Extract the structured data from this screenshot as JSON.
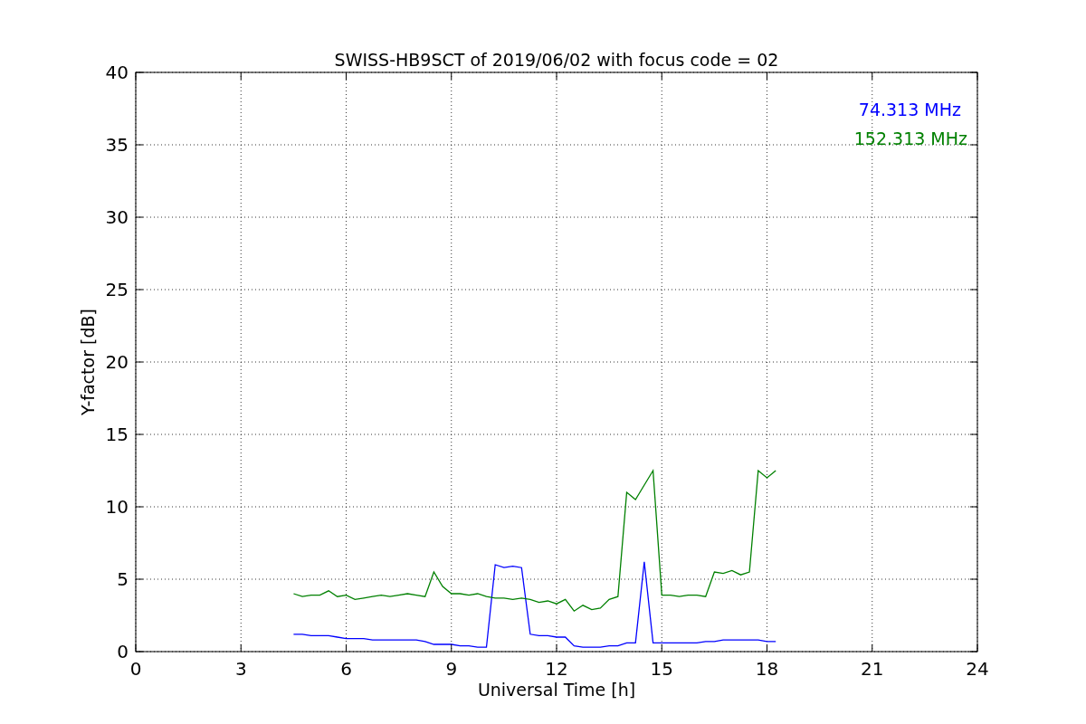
{
  "chart_data": {
    "type": "line",
    "title": "SWISS-HB9SCT of 2019/06/02 with focus code = 02",
    "xlabel": "Universal Time [h]",
    "ylabel": "Y-factor [dB]",
    "x": [
      4.5,
      4.75,
      5,
      5.25,
      5.5,
      5.75,
      6,
      6.25,
      6.5,
      6.75,
      7,
      7.25,
      7.5,
      7.75,
      8,
      8.25,
      8.5,
      8.75,
      9,
      9.25,
      9.5,
      9.75,
      10,
      10.25,
      10.5,
      10.75,
      11,
      11.25,
      11.5,
      11.75,
      12,
      12.25,
      12.5,
      12.75,
      13,
      13.25,
      13.5,
      13.75,
      14,
      14.25,
      14.5,
      14.75,
      15,
      15.25,
      15.5,
      15.75,
      16,
      16.25,
      16.5,
      16.75,
      17,
      17.25,
      17.5,
      17.75,
      18,
      18.25
    ],
    "series": [
      {
        "name": "74.313 MHz",
        "color": "#0000ff",
        "values": [
          1.2,
          1.2,
          1.1,
          1.1,
          1.1,
          1.0,
          0.9,
          0.9,
          0.9,
          0.8,
          0.8,
          0.8,
          0.8,
          0.8,
          0.8,
          0.7,
          0.5,
          0.5,
          0.5,
          0.4,
          0.4,
          0.3,
          0.3,
          6.0,
          5.8,
          5.9,
          5.8,
          1.2,
          1.1,
          1.1,
          1.0,
          1.0,
          0.4,
          0.3,
          0.3,
          0.3,
          0.4,
          0.4,
          0.6,
          0.6,
          6.2,
          0.6,
          0.6,
          0.6,
          0.6,
          0.6,
          0.6,
          0.7,
          0.7,
          0.8,
          0.8,
          0.8,
          0.8,
          0.8,
          0.7,
          0.7
        ]
      },
      {
        "name": "152.313 MHz",
        "color": "#008000",
        "values": [
          4.0,
          3.8,
          3.9,
          3.9,
          4.2,
          3.8,
          3.9,
          3.6,
          3.7,
          3.8,
          3.9,
          3.8,
          3.9,
          4.0,
          3.9,
          3.8,
          5.5,
          4.5,
          4.0,
          4.0,
          3.9,
          4.0,
          3.8,
          3.7,
          3.7,
          3.6,
          3.7,
          3.6,
          3.4,
          3.5,
          3.3,
          3.6,
          2.8,
          3.2,
          2.9,
          3.0,
          3.6,
          3.8,
          11.0,
          10.5,
          11.5,
          12.5,
          3.9,
          3.9,
          3.8,
          3.9,
          3.9,
          3.8,
          5.5,
          5.4,
          5.6,
          5.3,
          5.5,
          12.5,
          12.0,
          12.5
        ]
      }
    ],
    "xlim": [
      0,
      24
    ],
    "ylim": [
      0,
      40
    ],
    "xticks": [
      0,
      3,
      6,
      9,
      12,
      15,
      18,
      21,
      24
    ],
    "yticks": [
      0,
      5,
      10,
      15,
      20,
      25,
      30,
      35,
      40
    ],
    "grid": true
  }
}
